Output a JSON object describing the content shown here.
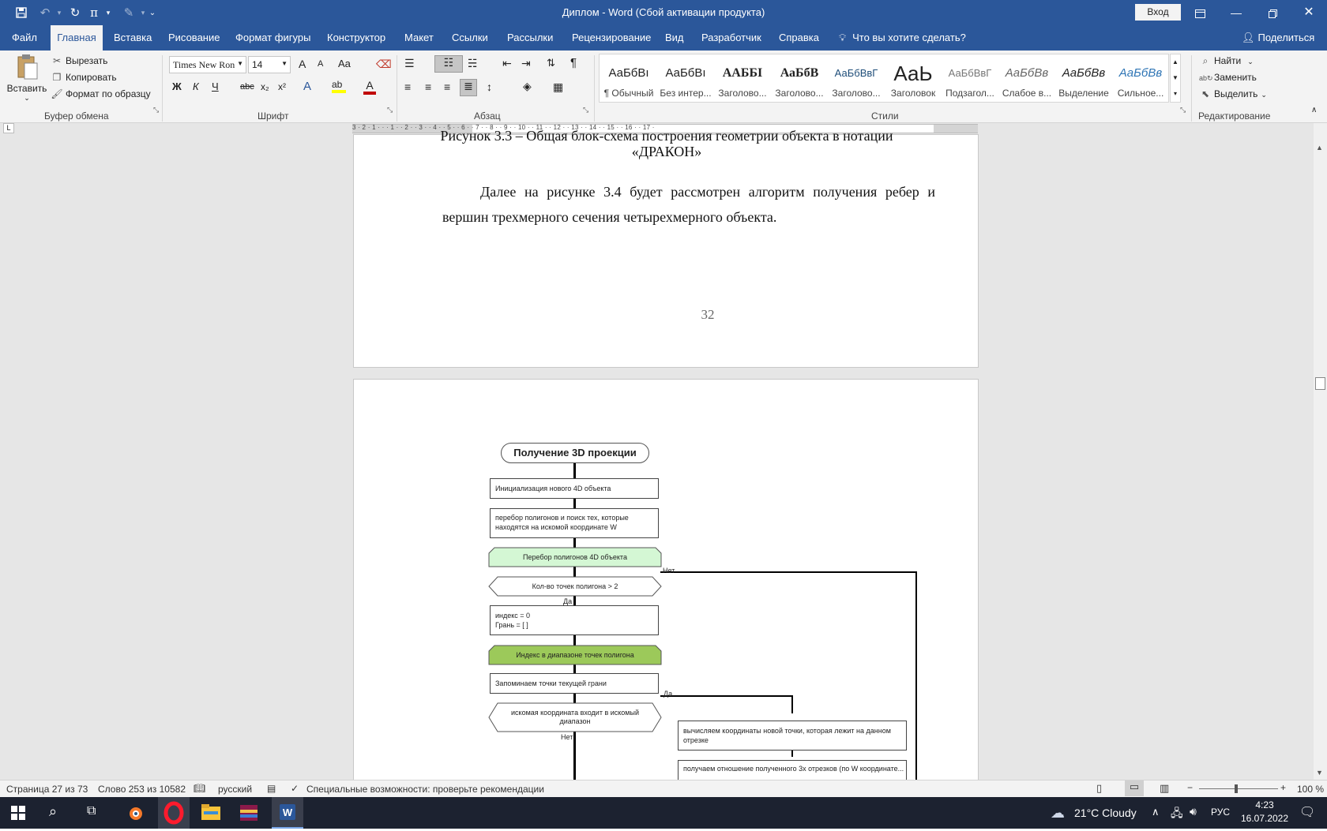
{
  "titlebar": {
    "doc_title": "Диплом  -  Word (Сбой активации продукта)",
    "login": "Вход",
    "pi": "π"
  },
  "tabs": [
    "Файл",
    "Главная",
    "Вставка",
    "Рисование",
    "Формат фигуры",
    "Конструктор",
    "Макет",
    "Ссылки",
    "Рассылки",
    "Рецензирование",
    "Вид",
    "Разработчик",
    "Справка"
  ],
  "tell_me": "Что вы хотите сделать?",
  "share": "Поделиться",
  "clipboard": {
    "paste": "Вставить",
    "cut": "Вырезать",
    "copy": "Копировать",
    "format_painter": "Формат по образцу",
    "label": "Буфер обмена"
  },
  "font": {
    "name": "Times New Ron",
    "size": "14",
    "label": "Шрифт",
    "bold": "Ж",
    "italic": "К",
    "underline": "Ч",
    "strike": "abc",
    "sub": "x₂",
    "sup": "x²",
    "case": "Aa",
    "grow": "A",
    "shrink": "A"
  },
  "paragraph": {
    "label": "Абзац"
  },
  "styles": {
    "label": "Стили",
    "items": [
      {
        "sample": "АаБбВı",
        "name": "¶ Обычный"
      },
      {
        "sample": "АаБбВı",
        "name": "Без интер..."
      },
      {
        "sample": "ААББІ",
        "name": "Заголово..."
      },
      {
        "sample": "АаБбВ",
        "name": "Заголово..."
      },
      {
        "sample": "АаБбВвГ",
        "name": "Заголово..."
      },
      {
        "sample": "АаЬ",
        "name": "Заголовок"
      },
      {
        "sample": "АаБбВвГ",
        "name": "Подзагол..."
      },
      {
        "sample": "АаБбВв",
        "name": "Слабое в..."
      },
      {
        "sample": "АаБбВв",
        "name": "Выделение"
      },
      {
        "sample": "АаБбВв",
        "name": "Сильное..."
      }
    ]
  },
  "editing": {
    "find": "Найти",
    "replace": "Заменить",
    "select": "Выделить",
    "label": "Редактирование"
  },
  "ruler": "3 · 2 · 1 · · · 1 · · 2 · · 3 · · 4 · · 5 · · 6 · · 7 · · 8 · · 9 · · 10 · · 11 · · 12 · · 13 · · 14 · · 15 · · 16 · · 17 ·",
  "page1": {
    "caption_top": "Рисунок 3.3 – Общая блок-схема построения геометрии объекта в нотации",
    "caption_bottom": "«ДРАКОН»",
    "paragraph_line1": "Далее на рисунке 3.4 будет рассмотрен алгоритм получения ребер и",
    "paragraph_line2": "вершин трехмерного сечения четырехмерного объекта.",
    "page_number": "32"
  },
  "flowchart": {
    "title": "Получение 3D проекции",
    "init": "Инициализация нового 4D объекта",
    "iterate": "перебор полигонов и поиск тех, которые находятся на искомой координате W",
    "loop1": "Перебор полигонов 4D объекта",
    "cond1": "Кол-во точек полигона > 2",
    "no1": "Нет",
    "yes1": "Да",
    "index": "индекс = 0\nГрань = [ ]",
    "loop2": "Индекс в диапазоне точек полигона",
    "remember": "Запоминаем точки текущей грани",
    "cond2": "искомая координата входит в искомый диапазон",
    "yes2": "Да",
    "no2": "Нет",
    "calc": "вычисляем координаты новой точки, которая лежит на данном отрезке",
    "ratio": "получаем отношение полученного 3х отрезков (по W координате..."
  },
  "status": {
    "page": "Страница 27 из 73",
    "words": "Слово 253 из 10582",
    "lang": "русский",
    "accessibility": "Специальные возможности: проверьте рекомендации",
    "zoom": "100 %"
  },
  "taskbar": {
    "weather": "21°C  Cloudy",
    "lang": "РУС",
    "time": "4:23",
    "date": "16.07.2022"
  },
  "colors": {
    "word_blue": "#2b579a",
    "loop_light": "#d4f7d4",
    "loop_dark": "#9cc95a"
  }
}
